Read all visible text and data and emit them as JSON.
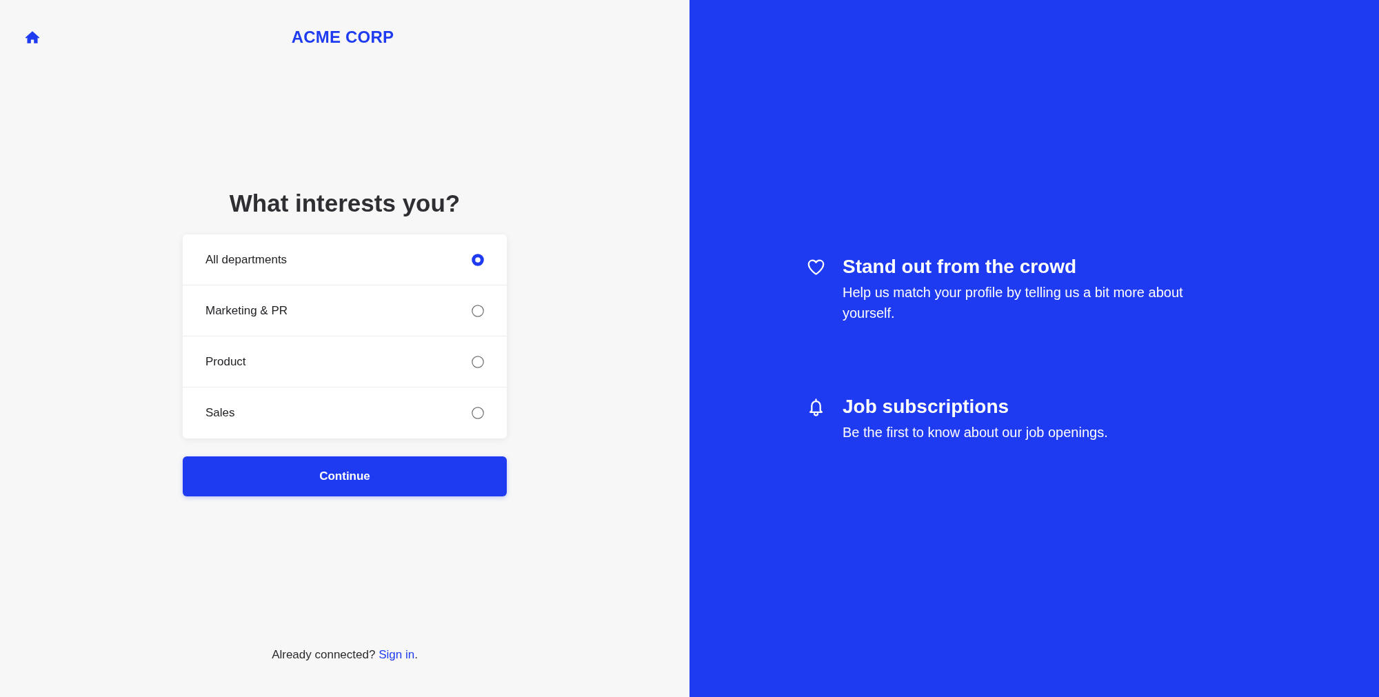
{
  "header": {
    "logo": "ACME CORP"
  },
  "form": {
    "heading": "What interests you?",
    "options": [
      {
        "label": "All departments",
        "selected": true
      },
      {
        "label": "Marketing & PR",
        "selected": false
      },
      {
        "label": "Product",
        "selected": false
      },
      {
        "label": "Sales",
        "selected": false
      }
    ],
    "submit_button": "Continue"
  },
  "footer": {
    "prompt": "Already connected?",
    "link": "Sign in",
    "suffix": "."
  },
  "features": [
    {
      "title": "Stand out from the crowd",
      "description": "Help us match your profile by telling us a bit more about yourself."
    },
    {
      "title": "Job subscriptions",
      "description": "Be the first to know about our job openings."
    }
  ]
}
